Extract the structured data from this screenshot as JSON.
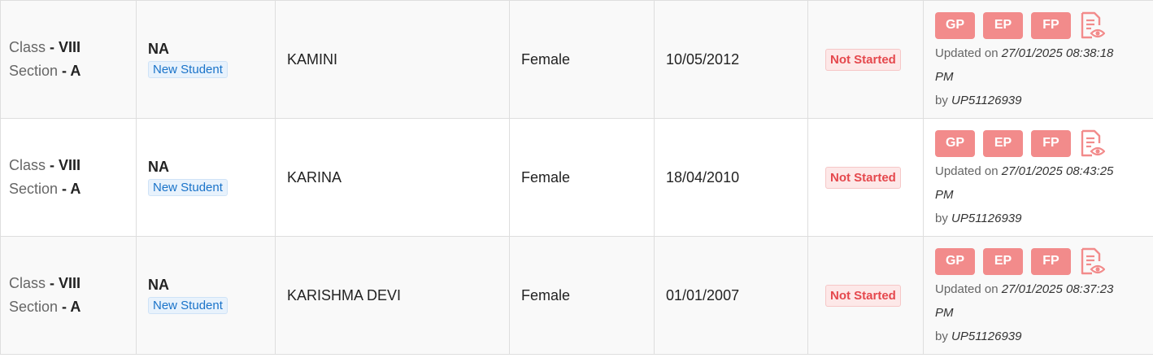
{
  "labels": {
    "class": "Class",
    "section": "Section",
    "dash": " - ",
    "updated_on": "Updated on",
    "by": "by",
    "gp": "GP",
    "ep": "EP",
    "fp": "FP",
    "pm": "PM"
  },
  "rows": [
    {
      "class": "VIII",
      "section": "A",
      "id": "NA",
      "tag": "New Student",
      "name": "KAMINI",
      "gender": "Female",
      "dob": "10/05/2012",
      "status": "Not Started",
      "updated": "27/01/2025 08:38:18",
      "user": "UP51126939"
    },
    {
      "class": "VIII",
      "section": "A",
      "id": "NA",
      "tag": "New Student",
      "name": "KARINA",
      "gender": "Female",
      "dob": "18/04/2010",
      "status": "Not Started",
      "updated": "27/01/2025 08:43:25",
      "user": "UP51126939"
    },
    {
      "class": "VIII",
      "section": "A",
      "id": "NA",
      "tag": "New Student",
      "name": "KARISHMA DEVI",
      "gender": "Female",
      "dob": "01/01/2007",
      "status": "Not Started",
      "updated": "27/01/2025 08:37:23",
      "user": "UP51126939"
    }
  ],
  "icons": {
    "view_report": "document-eye-icon"
  },
  "colors": {
    "action_button": "#f28b8b",
    "status_text": "#e5484d",
    "badge_text": "#1a73c9"
  }
}
